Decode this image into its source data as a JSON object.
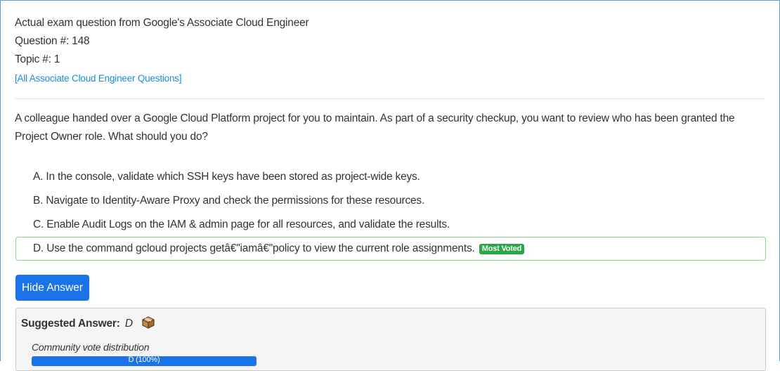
{
  "header": {
    "exam_line": "Actual exam question from Google's Associate Cloud Engineer",
    "question_number": "Question #: 148",
    "topic_number": "Topic #: 1",
    "all_questions_link": "[All Associate Cloud Engineer Questions]"
  },
  "question": {
    "text": "A colleague handed over a Google Cloud Platform project for you to maintain. As part of a security checkup, you want to review who has been granted the Project Owner role. What should you do?"
  },
  "choices": [
    {
      "text": "A. In the console, validate which SSH keys have been stored as project-wide keys."
    },
    {
      "text": "B. Navigate to Identity-Aware Proxy and check the permissions for these resources."
    },
    {
      "text": "C. Enable Audit Logs on the IAM & admin page for all resources, and validate the results."
    },
    {
      "text": "D. Use the command gcloud projects getâ€\"iamâ€\"policy to view the current role assignments.",
      "badge": "Most Voted"
    }
  ],
  "hide_answer_button": "Hide Answer",
  "answer": {
    "label": "Suggested Answer:",
    "value": "D",
    "vote_label": "Community vote distribution",
    "vote_bar_text": "D (100%)",
    "vote_percent": 100
  },
  "colors": {
    "link": "#1a8cd8",
    "primary": "#1a73e8",
    "most_voted_badge": "#28a745",
    "correct_border": "#8ed38e"
  }
}
